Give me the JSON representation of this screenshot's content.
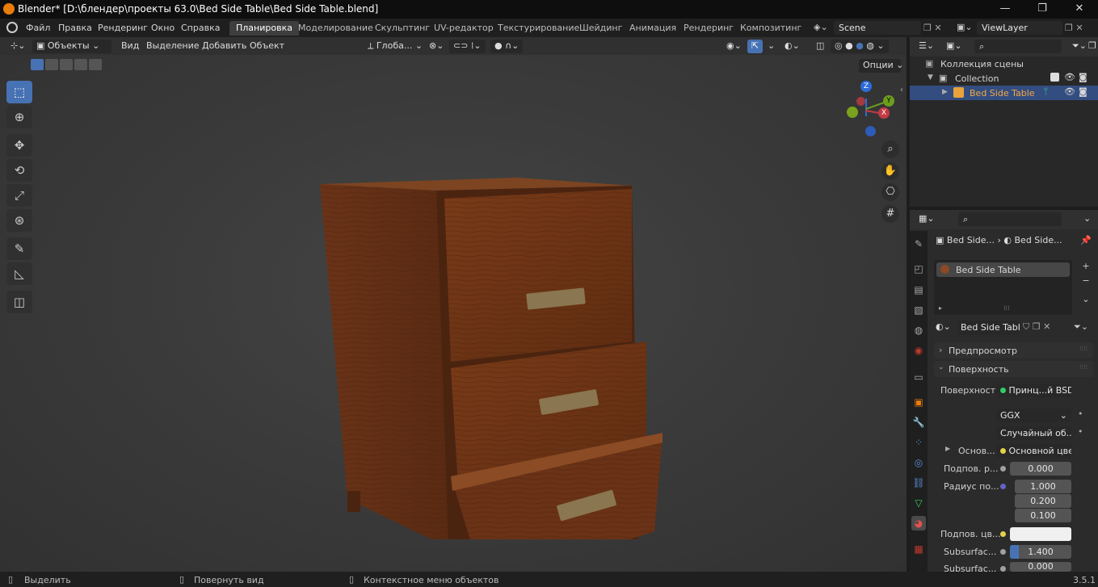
{
  "window": {
    "title": "Blender* [D:\\блендер\\проекты 63.0\\Bed Side Table\\Bed Side Table.blend]",
    "minimize": "—",
    "maximize": "❐",
    "close": "✕"
  },
  "menu": [
    "Файл",
    "Правка",
    "Рендеринг",
    "Окно",
    "Справка"
  ],
  "workspaces": [
    "Планировка",
    "Моделирование",
    "Скульптинг",
    "UV-редактор",
    "Текстурирование",
    "Шейдинг",
    "Анимация",
    "Рендеринг",
    "Композитинг"
  ],
  "active_workspace": "Планировка",
  "scene": {
    "name": "Scene"
  },
  "view_layer": {
    "name": "ViewLayer"
  },
  "viewport_header": {
    "mode": "Объекты",
    "menus": [
      "Вид",
      "Выделение",
      "Добавить",
      "Объект"
    ],
    "transform_orientation": "Глоба...",
    "options": "Опции"
  },
  "tools": [
    "select-box",
    "cursor",
    "move",
    "rotate",
    "scale",
    "transform",
    "annotate",
    "measure",
    "add-cube"
  ],
  "gizmo": {
    "z": "Z",
    "y": "Y",
    "x": "X"
  },
  "outliner": {
    "scene_collection": "Коллекция сцены",
    "collection": "Collection",
    "object": "Bed Side Table"
  },
  "properties": {
    "breadcrumb": [
      "Bed Side...",
      "Bed Side..."
    ],
    "material_slot": "Bed Side Table",
    "material_name": "Bed Side Table",
    "panel_preview": "Предпросмотр",
    "panel_surface": "Поверхность",
    "surface_label": "Поверхность",
    "surface_value": "Принц...й BSDF",
    "distribution": "GGX",
    "subsurface_method": "Случайный об...",
    "base_color_label": "Основ...",
    "base_color_value": "Основной цвет",
    "subsurface_label": "Подпов. р...",
    "subsurface_value": "0.000",
    "radius_label": "Радиус по...",
    "radius_values": [
      "1.000",
      "0.200",
      "0.100"
    ],
    "subsurface_color_label": "Подпов. цв...",
    "subsurface_ior_label": "Subsurfac...",
    "subsurface_ior_value": "1.400",
    "subsurface_aniso_label": "Subsurfac...",
    "subsurface_aniso_value": "0.000",
    "subsurface_ior_fill": 0.14
  },
  "status": {
    "left": "Выделить",
    "middle": "Повернуть вид",
    "right": "Контекстное меню объектов",
    "version": "3.5.1"
  },
  "colors": {
    "accent": "#4772b3",
    "selected_row": "#334d80",
    "object_text": "#f4a940",
    "wood": "#6b3316"
  }
}
